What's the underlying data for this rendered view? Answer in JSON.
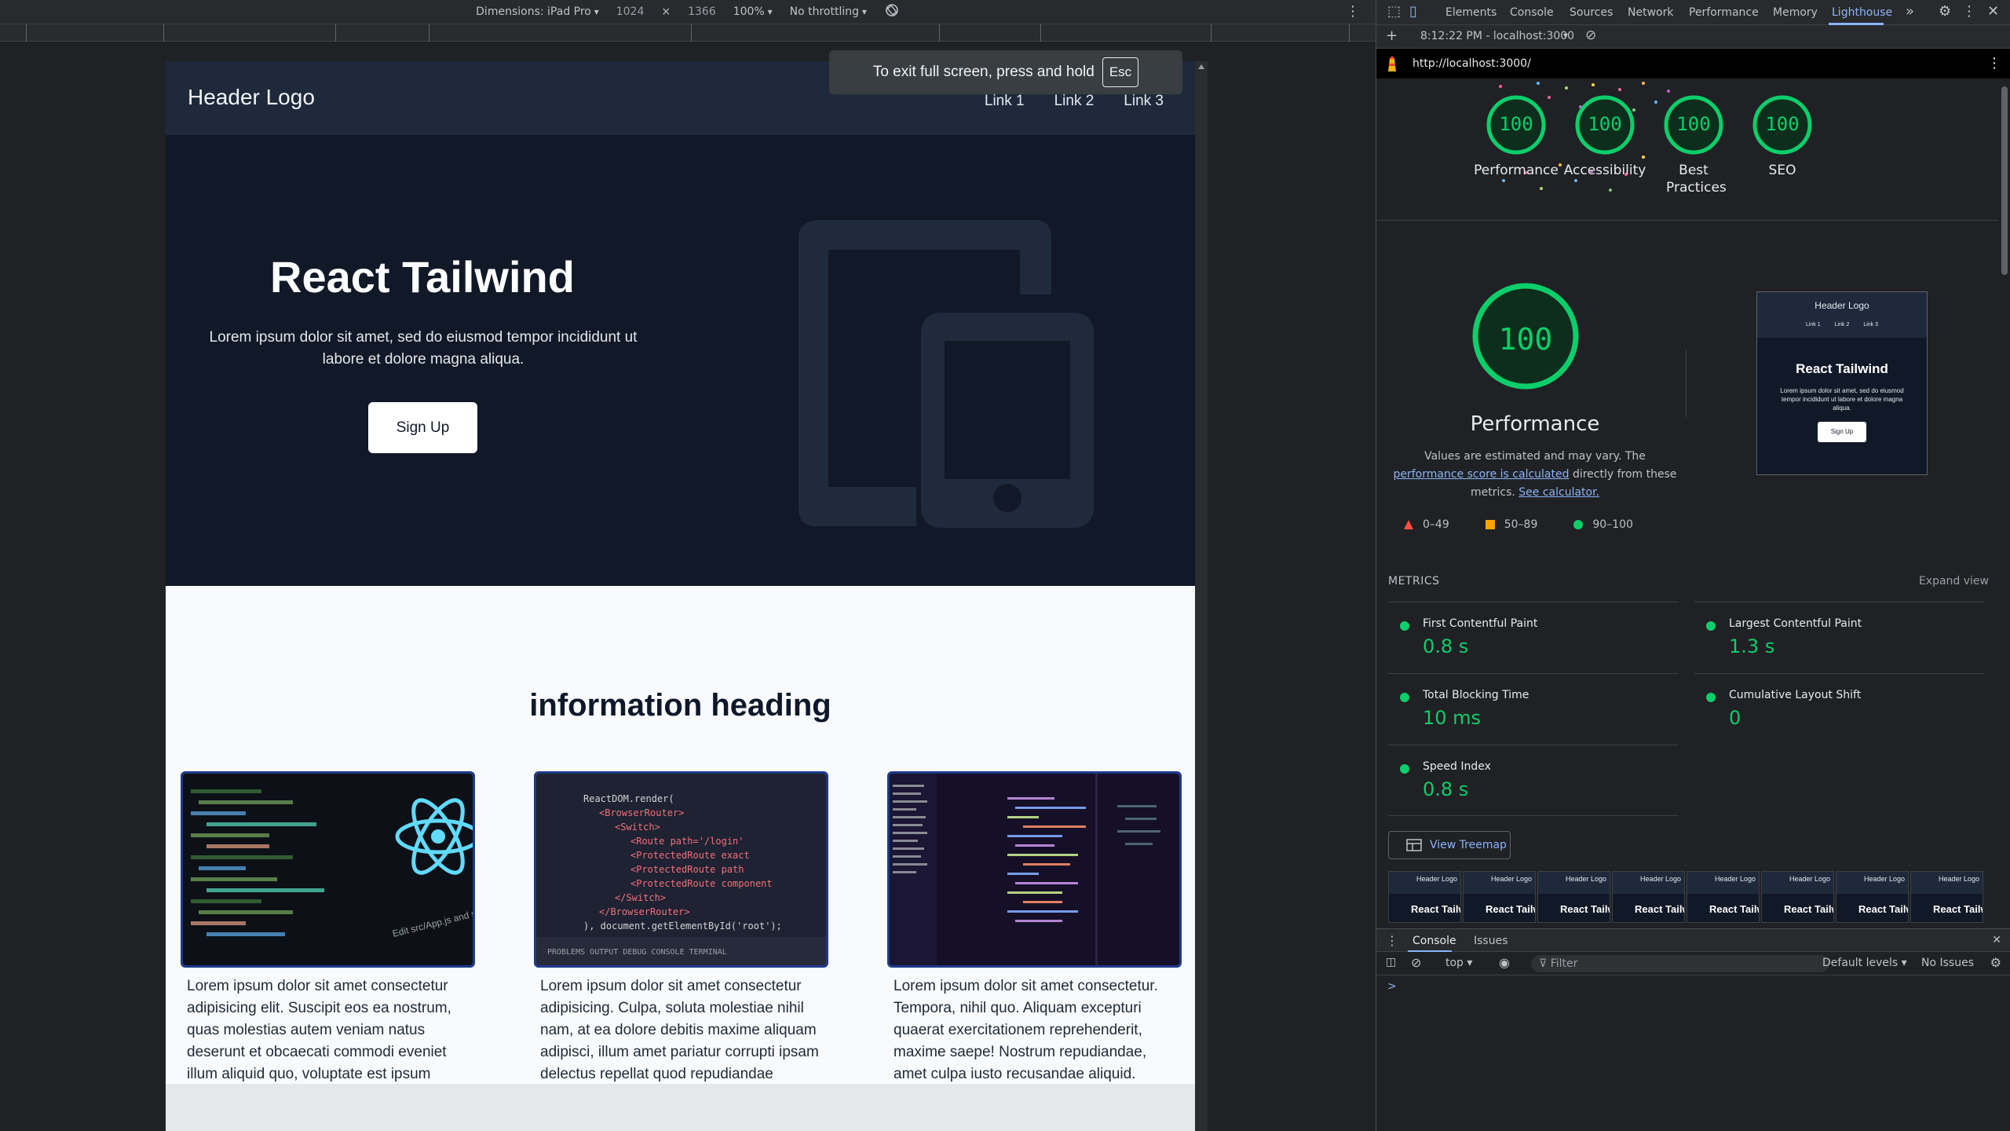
{
  "device_toolbar": {
    "dimensions_label": "Dimensions: iPad Pro",
    "width": "1024",
    "times": "×",
    "height": "1366",
    "zoom": "100%",
    "throttling": "No throttling"
  },
  "fullscreen_toast": {
    "text": "To exit full screen, press and hold",
    "key": "Esc"
  },
  "site": {
    "logo": "Header Logo",
    "nav": [
      "Link 1",
      "Link 2",
      "Link 3"
    ],
    "hero_title": "React Tailwind",
    "hero_text": "Lorem ipsum dolor sit amet, sed do eiusmod tempor incididunt ut labore et dolore magna aliqua.",
    "signup": "Sign Up",
    "info_heading": "information heading",
    "cards": [
      {
        "text": "Lorem ipsum dolor sit amet consectetur adipisicing elit. Suscipit eos ea nostrum, quas molestias autem veniam natus deserunt et obcaecati commodi eveniet illum aliquid quo, voluptate est ipsum idperferendis?"
      },
      {
        "text": "Lorem ipsum dolor sit amet consectetur adipisicing. Culpa, soluta molestiae nihil nam, at ea dolore debitis maxime aliquam adipisci, illum amet pariatur corrupti ipsam delectus repellat quod repudiandae minus?"
      },
      {
        "text": "Lorem ipsum dolor sit amet consectetur. Tempora, nihil quo. Aliquam excepturi quaerat exercitationem reprehenderit, maxime saepe! Nostrum repudiandae, amet culpa iusto recusandae aliquid. Dolor iure saepe nobis fugit."
      }
    ]
  },
  "devtools": {
    "tabs": [
      "Elements",
      "Console",
      "Sources",
      "Network",
      "Performance",
      "Memory",
      "Lighthouse"
    ],
    "active_tab": "Lighthouse",
    "report_selector": "8:12:22 PM - localhost:3000",
    "url": "http://localhost:3000/",
    "gauges": [
      {
        "score": "100",
        "label": "Performance"
      },
      {
        "score": "100",
        "label": "Accessibility"
      },
      {
        "score": "100",
        "label": "Best Practices"
      },
      {
        "score": "100",
        "label": "SEO"
      }
    ],
    "perf_score": "100",
    "perf_title": "Performance",
    "perf_note_a": "Values are estimated and may vary. The ",
    "perf_note_link1": "performance score is calculated",
    "perf_note_b": " directly from these metrics. ",
    "perf_note_link2": "See calculator.",
    "legend": [
      "0–49",
      "50–89",
      "90–100"
    ],
    "screenshot": {
      "logo": "Header Logo",
      "links": [
        "Link 1",
        "Link 2",
        "Link 3"
      ],
      "title": "React Tailwind",
      "text": "Lorem ipsum dolor sit amet, sed do eiusmod tempor incididunt ut labore et dolore magna aliqua.",
      "button": "Sign Up"
    },
    "metrics_title": "METRICS",
    "expand_view": "Expand view",
    "metrics": [
      {
        "name": "First Contentful Paint",
        "value": "0.8 s"
      },
      {
        "name": "Largest Contentful Paint",
        "value": "1.3 s"
      },
      {
        "name": "Total Blocking Time",
        "value": "10 ms"
      },
      {
        "name": "Cumulative Layout Shift",
        "value": "0"
      },
      {
        "name": "Speed Index",
        "value": "0.8 s"
      }
    ],
    "view_treemap": "View Treemap",
    "filmstrip": {
      "logo": "Header Logo",
      "title": "React Tailwi"
    },
    "drawer_tabs": [
      "Console",
      "Issues"
    ],
    "console": {
      "context": "top",
      "filter_placeholder": "Filter",
      "levels": "Default levels",
      "issues": "No Issues",
      "prompt": ">"
    }
  },
  "colors": {
    "pass": "#0cce6b",
    "average": "#ffa400",
    "fail": "#ff4e42",
    "accent": "#8ab4f8"
  }
}
